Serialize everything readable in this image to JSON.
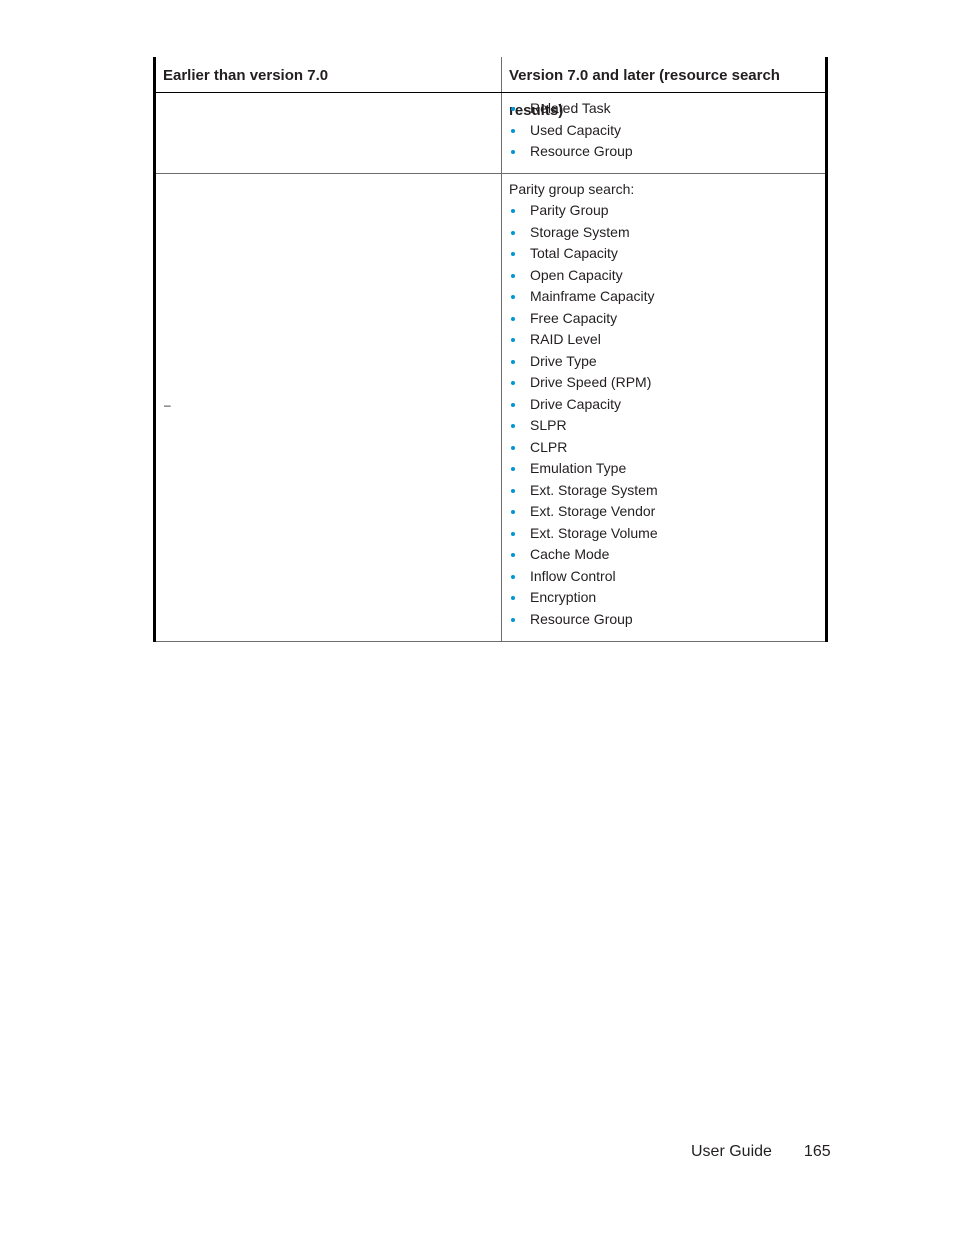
{
  "table": {
    "headers": [
      "Earlier than version 7.0",
      "Version 7.0 and later (resource search results)"
    ],
    "rows": [
      {
        "left": "",
        "right_intro": "",
        "right_items": [
          "Related Task",
          "Used Capacity",
          "Resource Group"
        ]
      },
      {
        "left": "–",
        "right_intro": "Parity group search:",
        "right_items": [
          "Parity Group",
          "Storage System",
          "Total Capacity",
          "Open Capacity",
          "Mainframe Capacity",
          "Free Capacity",
          "RAID Level",
          "Drive Type",
          "Drive Speed (RPM)",
          "Drive Capacity",
          "SLPR",
          "CLPR",
          "Emulation Type",
          "Ext. Storage System",
          "Ext. Storage Vendor",
          "Ext. Storage Volume",
          "Cache Mode",
          "Inflow Control",
          "Encryption",
          "Resource Group"
        ]
      }
    ]
  },
  "footer": {
    "title": "User Guide",
    "page_number": "165"
  },
  "colors": {
    "bullet": "#0096d6"
  }
}
